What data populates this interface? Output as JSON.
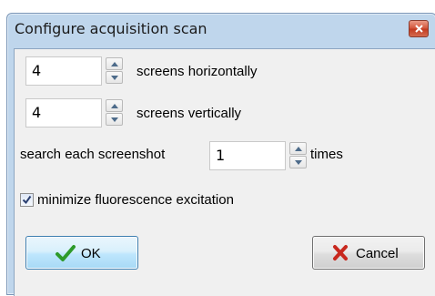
{
  "window": {
    "title": "Configure acquisition scan"
  },
  "horizontal": {
    "value": "4",
    "label": "screens horizontally"
  },
  "vertical": {
    "value": "4",
    "label": "screens vertically"
  },
  "search": {
    "label_before": "search each screenshot",
    "value": "1",
    "label_after": "times"
  },
  "minimize": {
    "label": "minimize fluorescence excitation",
    "checked": true
  },
  "buttons": {
    "ok_label": "OK",
    "cancel_label": "Cancel"
  },
  "icons": {
    "close": "close-icon",
    "spin_up": "arrow-up-icon",
    "spin_down": "arrow-down-icon",
    "check": "checkmark-icon",
    "ok": "green-check-icon",
    "cancel": "red-x-icon"
  },
  "colors": {
    "frame": "#bfd6ec",
    "client": "#f0f0f0",
    "ok_check": "#2e9a2a",
    "cancel_x": "#c8281e",
    "close_button": "#c94d33"
  }
}
